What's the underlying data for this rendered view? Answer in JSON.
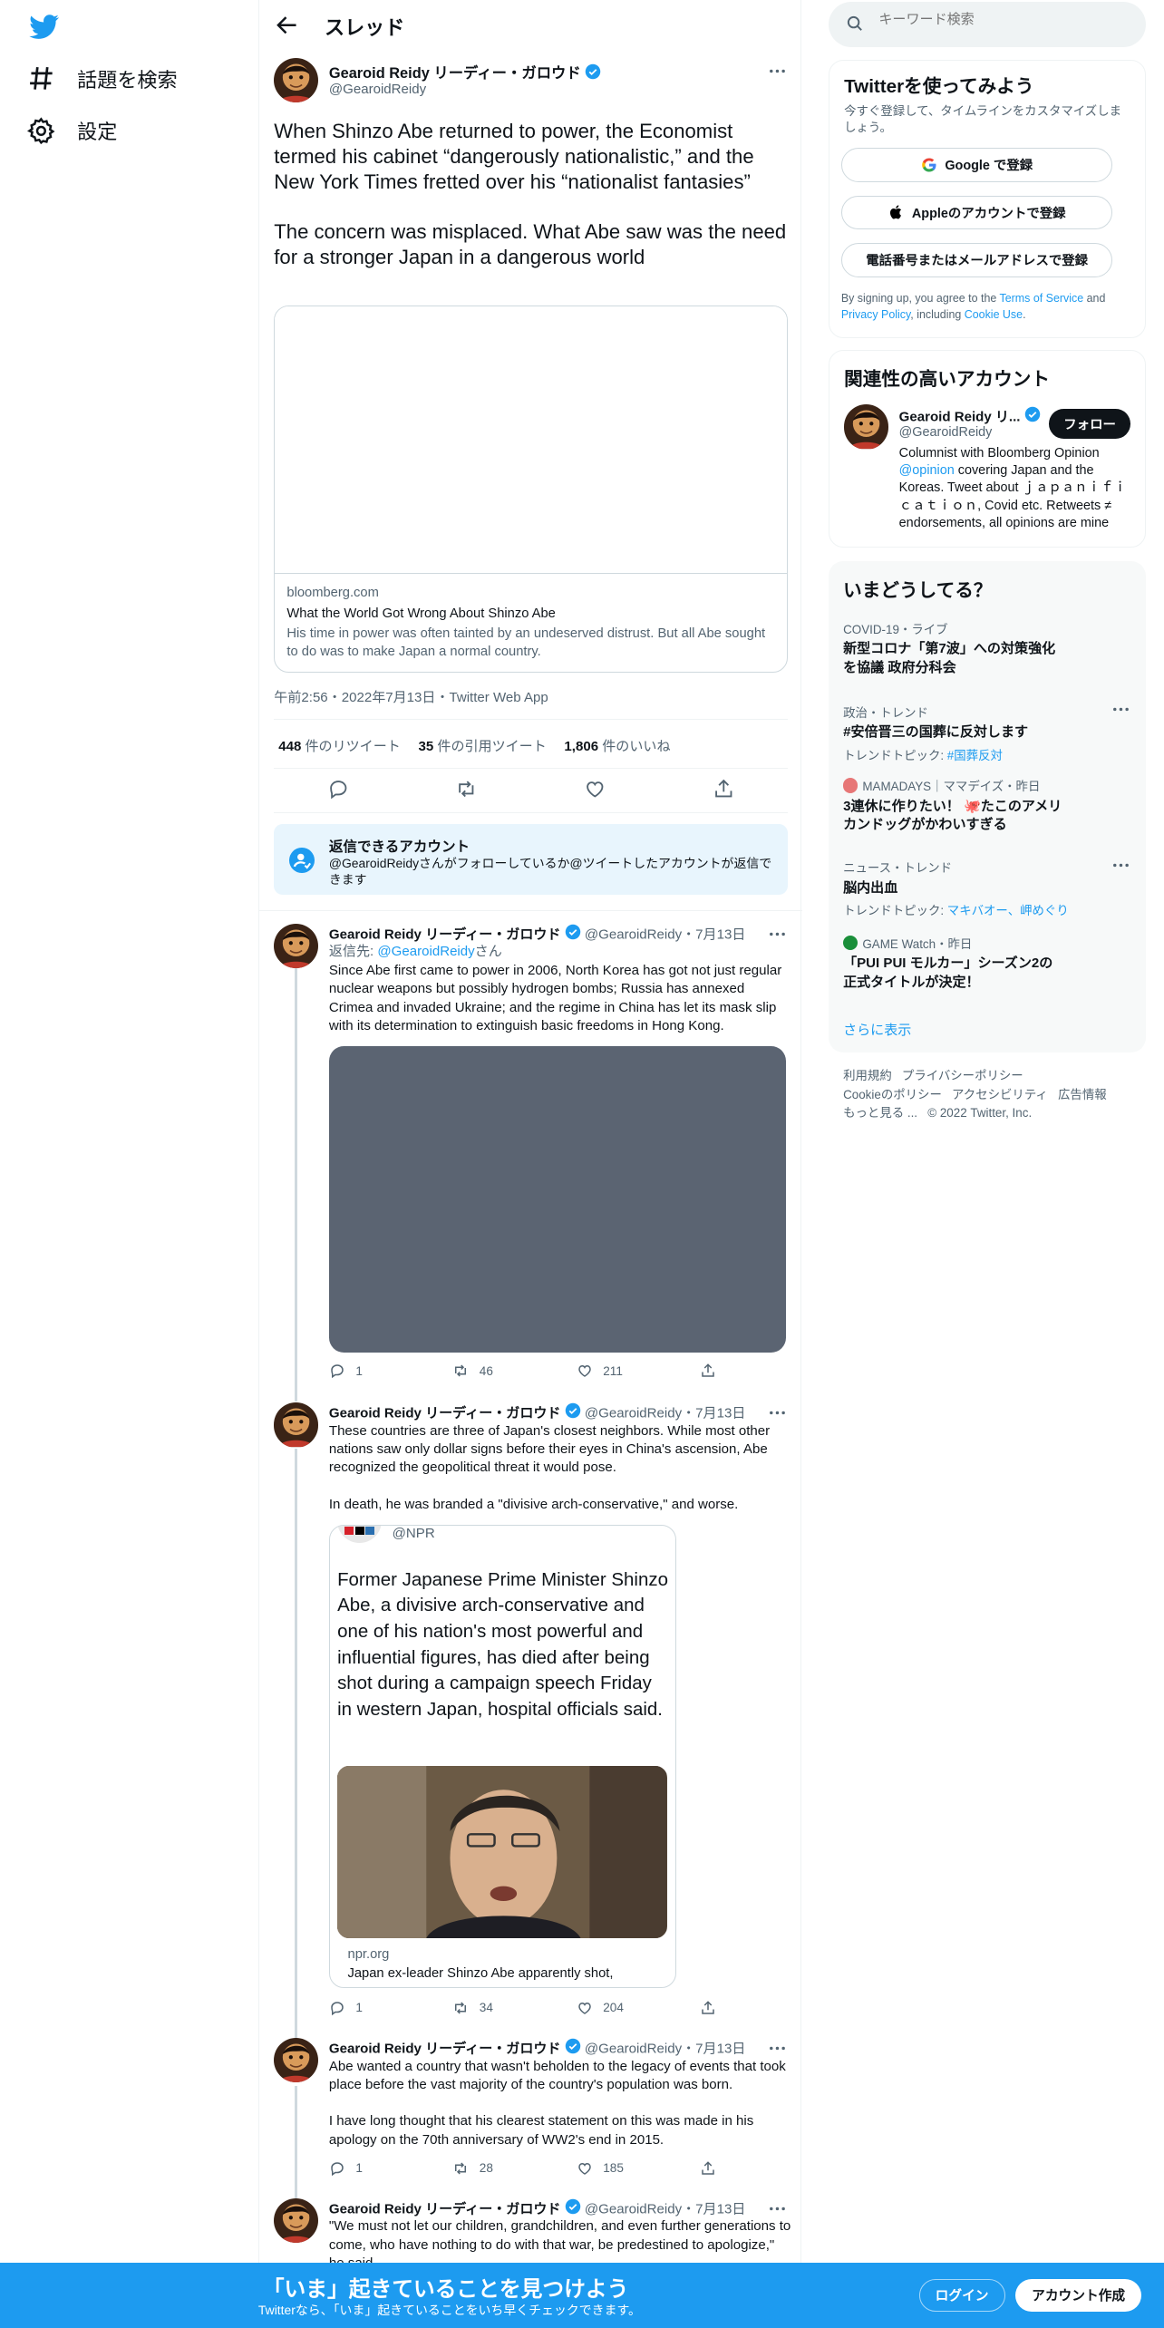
{
  "nav": {
    "explore_label": "話題を検索",
    "settings_label": "設定"
  },
  "header": {
    "title": "スレッド"
  },
  "main_tweet": {
    "name": "Gearoid Reidy リーディー・ガロウド",
    "handle": "@GearoidReidy",
    "text_p1": "When Shinzo Abe returned to power, the Economist termed his cabinet “dangerously nationalistic,” and the New York Times fretted over his “nationalist fantasies”",
    "text_p2": "The concern was misplaced. What Abe saw was the need for a stronger Japan in a dangerous world",
    "card_domain": "bloomberg.com",
    "card_title": "What the World Got Wrong About Shinzo Abe",
    "card_desc": "His time in power was often tainted by an undeserved distrust. But all Abe sought to do was to make Japan a normal country.",
    "timestamp": "午前2:56・2022年7月13日・Twitter Web App",
    "retweets": "448",
    "retweets_label": "件のリツイート",
    "quotes": "35",
    "quotes_label": "件の引用ツイート",
    "likes": "1,806",
    "likes_label": "件のいいね"
  },
  "reply_box": {
    "title": "返信できるアカウント",
    "desc": "@GearoidReidyさんがフォローしているか@ツイートしたアカウントが返信できます"
  },
  "replies": [
    {
      "name": "Gearoid Reidy リーディー・ガロウド",
      "handle": "@GearoidReidy・7月13日",
      "reply_to_prefix": "返信先: ",
      "reply_to": "@GearoidReidy",
      "reply_to_suffix": "さん",
      "text": "Since Abe first came to power in 2006, North Korea has got not just regular nuclear weapons but possibly hydrogen bombs; Russia has annexed Crimea and invaded Ukraine; and the regime in China has let its mask slip with its determination to extinguish basic freedoms in Hong Kong.",
      "replies": "1",
      "retweets": "46",
      "likes": "211"
    },
    {
      "name": "Gearoid Reidy リーディー・ガロウド",
      "handle": "@GearoidReidy・7月13日",
      "text_p1": "These countries are three of Japan's closest neighbors. While most other nations saw only dollar signs before their eyes in China's ascension, Abe recognized the geopolitical threat it would pose.",
      "text_p2": "In death, he was branded a \"divisive arch-conservative,\" and worse.",
      "quote_handle": "@NPR",
      "quote_text": "Former Japanese Prime Minister Shinzo Abe, a divisive arch-conservative and one of his nation's most powerful and influential figures, has died after being shot during a campaign speech Friday in western Japan, hospital officials said.",
      "quote_domain": "npr.org",
      "quote_title": "Japan ex-leader Shinzo Abe apparently shot,",
      "replies": "1",
      "retweets": "34",
      "likes": "204"
    },
    {
      "name": "Gearoid Reidy リーディー・ガロウド",
      "handle": "@GearoidReidy・7月13日",
      "text_p1": "Abe wanted a country that wasn't beholden to the legacy of events that took place before the vast majority of the country's population was born.",
      "text_p2": "I have long thought that his clearest statement on this was made in his apology on the 70th anniversary of WW2's end in 2015.",
      "replies": "1",
      "retweets": "28",
      "likes": "185"
    },
    {
      "name": "Gearoid Reidy リーディー・ガロウド",
      "handle": "@GearoidReidy・7月13日",
      "text": "\"We must not let our children, grandchildren, and even further generations to come, who have nothing to do with that war, be predestined to apologize,\" he said."
    }
  ],
  "search": {
    "placeholder": "キーワード検索"
  },
  "signup_panel": {
    "title": "Twitterを使ってみよう",
    "subtitle": "今すぐ登録して、タイムラインをカスタマイズしましょう。",
    "google": "Google で登録",
    "apple": "Appleのアカウントで登録",
    "phone": "電話番号またはメールアドレスで登録",
    "terms_prefix": "By signing up, you agree to the ",
    "terms": "Terms of Service",
    "and": " and ",
    "privacy": "Privacy Policy",
    "including": ", including ",
    "cookie": "Cookie Use",
    "period": "."
  },
  "related": {
    "title": "関連性の高いアカウント",
    "name": "Gearoid Reidy リ...",
    "handle": "@GearoidReidy",
    "follow": "フォロー",
    "bio_p1": "Columnist with Bloomberg Opinion ",
    "bio_link": "@opinion",
    "bio_p2": " covering Japan and the Koreas. Tweet about ｊａｐａｎｉｆｉｃａｔｉｏｎ, Covid etc. Retweets ≠ endorsements, all opinions are mine"
  },
  "trends": {
    "title": "いまどうしてる？",
    "items": [
      {
        "category": "COVID-19・ライブ",
        "title": "新型コロナ「第7波」への対策強化を協議 政府分科会",
        "sub": ""
      },
      {
        "category": "政治・トレンド",
        "title": "#安倍晋三の国葬に反対します",
        "sub_prefix": "トレンドトピック: ",
        "sub_link": "#国葬反対"
      },
      {
        "category": "MAMADAYS｜ママデイズ・昨日",
        "title": "3連休に作りたい！ 🐙たこのアメリカンドッグがかわいすぎる",
        "sub": ""
      },
      {
        "category": "ニュース・トレンド",
        "title": "脳内出血",
        "sub_prefix": "トレンドトピック: ",
        "sub_link": "マキバオー、岬めぐり"
      },
      {
        "category": "GAME Watch・昨日",
        "title": "「PUI PUI モルカー」シーズン2の正式タイトルが決定！",
        "sub": ""
      }
    ],
    "show_more": "さらに表示"
  },
  "footer": {
    "terms": "利用規約",
    "privacy": "プライバシーポリシー",
    "cookie": "Cookieのポリシー",
    "accessibility": "アクセシビリティ",
    "ads": "広告情報",
    "more": "もっと見る ...",
    "copyright": "© 2022 Twitter, Inc."
  },
  "bottom_bar": {
    "title": "「いま」起きていることを見つけよう",
    "subtitle": "Twitterなら、「いま」起きていることをいち早くチェックできます。",
    "login": "ログイン",
    "signup": "アカウント作成"
  },
  "colors": {
    "brand_blue": "#1d9bf0",
    "text_primary": "#0f1419",
    "text_secondary": "#536471",
    "border": "#eff3f4",
    "media_placeholder": "#5b6472"
  }
}
